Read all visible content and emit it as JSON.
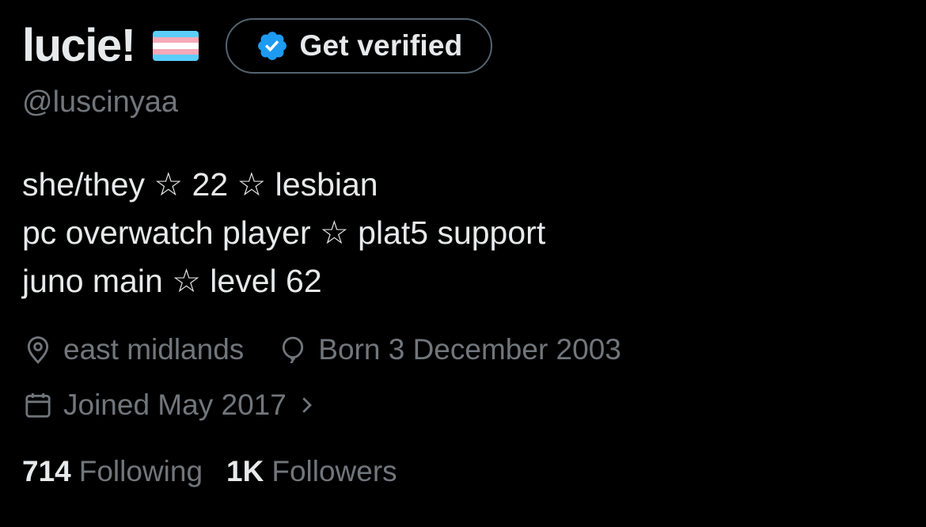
{
  "profile": {
    "display_name": "lucie!",
    "flag_icon": "transgender-flag",
    "flag_colors": [
      "#5BCEFA",
      "#F5A9B8",
      "#FFFFFF",
      "#F5A9B8",
      "#5BCEFA"
    ],
    "handle": "@luscinyaa",
    "verify_button": {
      "label": "Get verified",
      "icon": "verified-badge-icon",
      "badge_color": "#1D9BF0"
    },
    "bio": [
      "she/they ☆ 22 ☆ lesbian",
      "pc overwatch player ☆ plat5 support",
      "juno main ☆ level 62"
    ],
    "location": {
      "icon": "location-pin-icon",
      "text": "east midlands"
    },
    "birthday": {
      "icon": "balloon-icon",
      "text": "Born 3 December 2003"
    },
    "joined": {
      "icon": "calendar-icon",
      "text": "Joined May 2017",
      "chevron": "chevron-right-icon"
    },
    "stats": {
      "following": {
        "count": "714",
        "label": "Following"
      },
      "followers": {
        "count": "1K",
        "label": "Followers"
      }
    }
  },
  "colors": {
    "background": "#000000",
    "primary_text": "#e7e9ea",
    "secondary_text": "#71767b",
    "border": "#536471"
  }
}
